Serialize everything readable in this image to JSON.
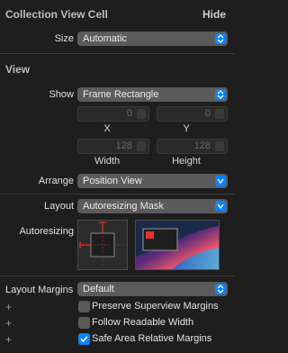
{
  "header": {
    "title": "Collection View Cell",
    "hide_label": "Hide"
  },
  "size": {
    "label": "Size",
    "value": "Automatic"
  },
  "view": {
    "title": "View",
    "show": {
      "label": "Show",
      "value": "Frame Rectangle"
    },
    "x": {
      "value": "0",
      "caption": "X"
    },
    "y": {
      "value": "0",
      "caption": "Y"
    },
    "width": {
      "value": "128",
      "caption": "Width"
    },
    "height": {
      "value": "128",
      "caption": "Height"
    },
    "arrange": {
      "label": "Arrange",
      "value": "Position View"
    }
  },
  "layout": {
    "label": "Layout",
    "value": "Autoresizing Mask"
  },
  "autoresizing": {
    "label": "Autoresizing"
  },
  "layout_margins": {
    "label": "Layout Margins",
    "value": "Default"
  },
  "options": [
    {
      "label": "Preserve Superview Margins",
      "checked": false
    },
    {
      "label": "Follow Readable Width",
      "checked": false
    },
    {
      "label": "Safe Area Relative Margins",
      "checked": true
    }
  ],
  "colors": {
    "accent": "#0a84ff",
    "autoresize_red": "#e8322a",
    "panel": "#1e1e1e"
  }
}
